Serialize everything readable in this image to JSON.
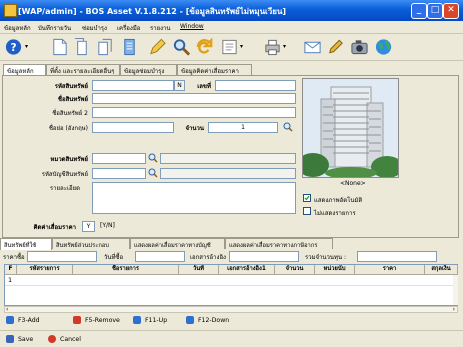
{
  "window": {
    "title": "[WAP/admin] - BOS Asset V.1.8.212 - [ข้อมูลสินทรัพย์ไม่หมุนเวียน]",
    "min": "_",
    "max": "□",
    "close": "✕"
  },
  "menu": [
    "ข้อมูลหลัก",
    "บันทึกรายวัน",
    "ซ่อมบำรุง",
    "เครื่องมือ",
    "รายงาน",
    "Window"
  ],
  "tabs": [
    "ข้อมูลหลัก",
    "ที่ตั้ง และรายละเอียดอื่นๆ",
    "ข้อมูลซ่อมบำรุง",
    "ข้อมูลคิดค่าเสื่อมราคา"
  ],
  "form": {
    "code_label": "รหัสสินทรัพย์",
    "flag": "N",
    "number_label": "เลขที่",
    "name_label": "ชื่อสินทรัพย์",
    "name2_label": "ชื่อสินทรัพย์ 2",
    "short_label": "ชื่อย่อ (อังกฤษ)",
    "qty_label": "จำนวน",
    "qty_value": "1",
    "category_label": "หมวดสินทรัพย์",
    "account_label": "รหัสบัญชีสินทรัพย์",
    "detail_label": "รายละเอียด",
    "depr_label": "คิดค่าเสื่อมราคา",
    "depr_value": "Y",
    "depr_hint": "[Y/N]"
  },
  "photo": {
    "caption": "<None>",
    "show_label": "แสดงภาพอัตโนมัติ",
    "noshow_label": "ไม่แสดงรายการ"
  },
  "lower_tabs": [
    "สินทรัพย์ที่ใช้",
    "สินทรัพย์ส่วนประกอบ",
    "แสดงผลค่าเสื่อมราคาทางบัญชี",
    "แสดงผลค่าเสื่อมราคาทางภาษีอากร"
  ],
  "lower": {
    "price_label": "ราคาซื้อ",
    "date_label": "วันที่ซื้อ",
    "docref_label": "เอกสารอ้างอิง",
    "total_label": "รวมจำนวนทุน :"
  },
  "grid": {
    "columns": [
      "F",
      "รหัสรายการ",
      "ชื่อรายการ",
      "วันที่",
      "เอกสารอ้างอิง1",
      "จำนวน",
      "หน่วยนับ",
      "ราคา",
      "สกุลเงิน"
    ],
    "rows": [
      [
        "1",
        "",
        "",
        "",
        "",
        "",
        "",
        "",
        ""
      ]
    ]
  },
  "footer": {
    "add": "F3-Add",
    "remove": "F5-Remove",
    "up": "F11-Up",
    "down": "F12-Down"
  },
  "status": {
    "save": "Save",
    "cancel": "Cancel"
  },
  "colors": {
    "titlebar": "#0a5fd8",
    "face": "#ece9d8",
    "field_border": "#7f9db9"
  }
}
